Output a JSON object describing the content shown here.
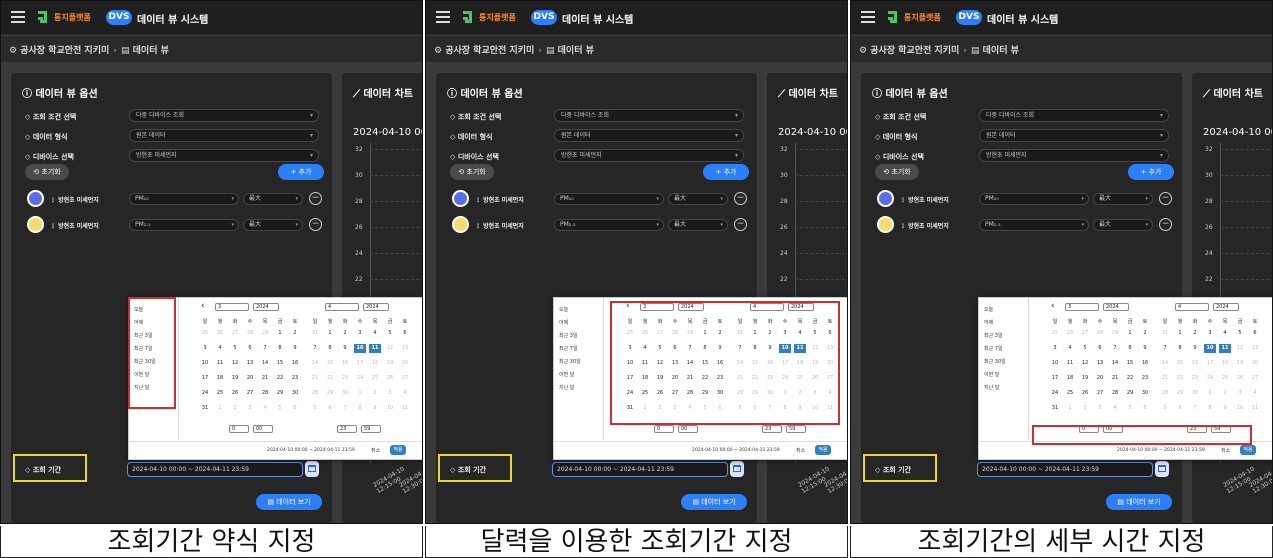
{
  "app": {
    "logo_text": "통지플랫폼",
    "badge": "DVS",
    "title": "데이터 뷰 시스템"
  },
  "breadcrumb": {
    "site": "공사장 학교안전 지키미",
    "page": "데이터 뷰"
  },
  "options": {
    "title": "데이터 뷰 옵션",
    "rows": [
      {
        "label": "조회 조건 선택",
        "value": "다중 디바이스 조회"
      },
      {
        "label": "데이터 형식",
        "value": "원본 데이터"
      },
      {
        "label": "디바이스 선택",
        "value": "방현초 미세먼지"
      }
    ],
    "reset_label": "초기화",
    "add_label": "추가",
    "devices": [
      {
        "name": "방현초 미세먼지",
        "metric": "PM₁₀",
        "agg": "最大",
        "color": "#5a6ee6"
      },
      {
        "name": "방현초 미세먼지",
        "metric": "PM₂.₅",
        "agg": "最大",
        "color": "#f2dc6b"
      }
    ],
    "period_label": "조회 기간",
    "period_value": "2024-04-10 00:00 ~ 2024-04-11 23:59",
    "view_label": "데이터 보기"
  },
  "chart": {
    "title": "데이터 차트",
    "date": "2024-04-10 00:00",
    "y_ticks": [
      "32",
      "30",
      "28",
      "26",
      "24",
      "22"
    ],
    "x_labels": [
      "2024-04-10 12:15:00",
      "2024-04-10 12:30:00",
      "202 12"
    ]
  },
  "picker": {
    "presets": [
      "오늘",
      "어제",
      "최근 3일",
      "최근 7일",
      "최근 30일",
      "이번 달",
      "지난 달"
    ],
    "left_month": "3",
    "left_year": "2024",
    "right_month": "4",
    "right_year": "2024",
    "weekdays": [
      "일",
      "월",
      "화",
      "수",
      "목",
      "금",
      "토"
    ],
    "left_days": [
      [
        "25",
        "26",
        "27",
        "28",
        "29",
        "1",
        "2"
      ],
      [
        "3",
        "4",
        "5",
        "6",
        "7",
        "8",
        "9"
      ],
      [
        "10",
        "11",
        "12",
        "13",
        "14",
        "15",
        "16"
      ],
      [
        "17",
        "18",
        "19",
        "20",
        "21",
        "22",
        "23"
      ],
      [
        "24",
        "25",
        "26",
        "27",
        "28",
        "29",
        "30"
      ],
      [
        "31",
        "1",
        "2",
        "3",
        "4",
        "5",
        "6"
      ]
    ],
    "right_days": [
      [
        "31",
        "1",
        "2",
        "3",
        "4",
        "5",
        "6"
      ],
      [
        "7",
        "8",
        "9",
        "10",
        "11",
        "12",
        "13"
      ],
      [
        "14",
        "15",
        "16",
        "17",
        "18",
        "19",
        "20"
      ],
      [
        "21",
        "22",
        "23",
        "24",
        "25",
        "26",
        "27"
      ],
      [
        "28",
        "29",
        "30",
        "1",
        "2",
        "3",
        "4"
      ],
      [
        "5",
        "6",
        "7",
        "8",
        "9",
        "10",
        "11"
      ]
    ],
    "start_hour": "0",
    "start_min": "00",
    "end_hour": "23",
    "end_min": "59",
    "footer_range": "2024-04-10 00:00 ~ 2024-04-11 23:59",
    "cancel_label": "취소",
    "apply_label": "적용"
  },
  "captions": [
    "조회기간 약식 지정",
    "달력을 이용한 조회기간 지정",
    "조회기간의 세부 시간 지정"
  ],
  "colors": {
    "accent": "#2d7ff9",
    "highlight_red": "#d62b2b",
    "highlight_yellow": "#e5d536"
  }
}
